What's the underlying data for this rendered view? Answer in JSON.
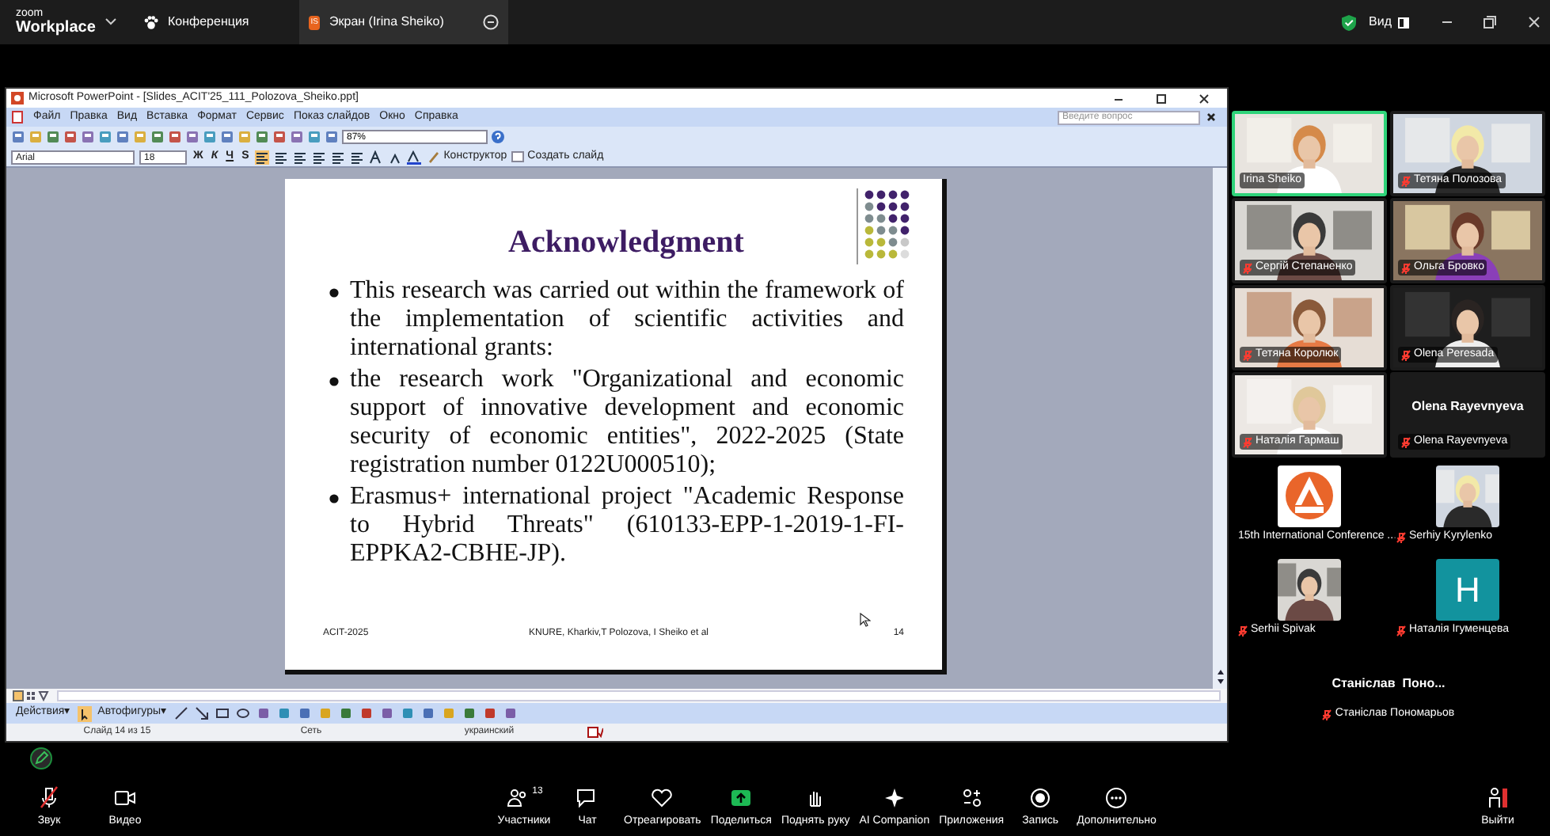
{
  "zoom": {
    "brand_top": "zoom",
    "brand": "Workplace",
    "tabs": [
      {
        "label": "Конференция",
        "selected": false
      },
      {
        "label": "Экран (Irina Sheiko)",
        "badge": "IS",
        "selected": true
      }
    ],
    "view_label": "Вид"
  },
  "powerpoint": {
    "title": "Microsoft PowerPoint - [Slides_ACIT'25_111_Polozova_Sheiko.ppt]",
    "menu": [
      "Файл",
      "Правка",
      "Вид",
      "Вставка",
      "Формат",
      "Сервис",
      "Показ слайдов",
      "Окно",
      "Справка"
    ],
    "help_placeholder": "Введите вопрос",
    "zoom_value": "87%",
    "font": "Arial",
    "font_size": "18",
    "format_buttons": [
      "Ж",
      "К",
      "Ч",
      "S"
    ],
    "designer": "Конструктор",
    "new_slide": "Создать слайд",
    "actions": "Действия▾",
    "autoshapes": "Автофигуры▾",
    "status": [
      "Слайд 14 из 15",
      "Сеть",
      "украинский"
    ]
  },
  "slide": {
    "title": "Acknowledgment",
    "bullets": [
      "This research was carried out within the framework of the implementation of scientific activities and international grants:",
      "the research work \"Organizational and economic support of innovative development and economic security of economic entities\", 2022-2025 (State registration number 0122U000510);",
      "Erasmus+ international project \"Academic Response to Hybrid Threats\" (610133-EPP-1-2019-1-FI-EPPKA2-CBHE-JP)."
    ],
    "footer_left": "ACIT-2025",
    "footer_center": "KNURE, Kharkiv,T Polozova, I Sheiko et al",
    "page": "14"
  },
  "participants": {
    "gallery": [
      {
        "name": "Irina Sheiko",
        "kind": "video",
        "muted": false,
        "speaking": true
      },
      {
        "name": "Тетяна Полозова",
        "kind": "video",
        "muted": true,
        "speaking": false
      },
      {
        "name": "Сергій Степаненко",
        "kind": "video",
        "muted": true,
        "speaking": false
      },
      {
        "name": "Ольга Бровко",
        "kind": "video",
        "muted": true,
        "speaking": false
      },
      {
        "name": "Тетяна Королюк",
        "kind": "video",
        "muted": true,
        "speaking": false
      },
      {
        "name": "Olena Peresada",
        "kind": "video",
        "muted": true,
        "speaking": false
      },
      {
        "name": "Наталія Гармаш",
        "kind": "video",
        "muted": true,
        "speaking": false
      },
      {
        "name": "Olena Rayevnyeva",
        "kind": "name",
        "display": "Olena Rayevnyeva",
        "muted": true,
        "speaking": false
      }
    ],
    "thumbnails": [
      {
        "name": "15th International Conference ...",
        "kind": "logo",
        "muted": false
      },
      {
        "name": "Serhiy Kyrylenko",
        "muted": true
      },
      {
        "name": "Serhii Spivak",
        "muted": true
      },
      {
        "name": "Наталія Ігуменцева",
        "kind": "letter",
        "letter": "H",
        "muted": true
      }
    ],
    "audio_only": {
      "name": "Станіслав Пономарьов",
      "display": "Станіслав  Поно...",
      "muted": true
    }
  },
  "toolbar": [
    {
      "label": "Звук",
      "kind": "mic",
      "muted": true
    },
    {
      "label": "Видео",
      "kind": "camera"
    },
    {
      "label": "Участники",
      "kind": "people",
      "count": "13"
    },
    {
      "label": "Чат",
      "kind": "chat"
    },
    {
      "label": "Отреагировать",
      "kind": "heart"
    },
    {
      "label": "Поделиться",
      "kind": "share"
    },
    {
      "label": "Поднять руку",
      "kind": "hand"
    },
    {
      "label": "AI Companion",
      "kind": "sparkle"
    },
    {
      "label": "Приложения",
      "kind": "apps"
    },
    {
      "label": "Запись",
      "kind": "record"
    },
    {
      "label": "Дополнительно",
      "kind": "more"
    },
    {
      "label": "Выйти",
      "kind": "leave"
    }
  ]
}
